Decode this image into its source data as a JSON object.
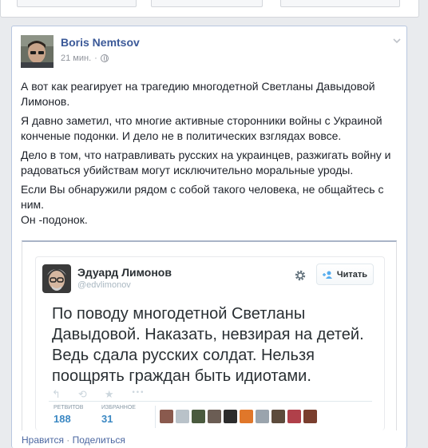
{
  "post": {
    "author": "Boris Nemtsov",
    "time": "21 мин.",
    "time_separator": "·",
    "paragraphs": [
      "А вот как реагирует на трагедию многодетной Светланы Давыдовой Лимонов.",
      "Я давно заметил, что многие активные сторонники войны с Украиной конченые подонки. И дело не в политических взглядах вовсе.",
      "Дело в том, что натравливать русских на украинцев, разжигать войну и радоваться убийствам могут исключительно моральные уроды.",
      "Если Вы обнаружили рядом с собой такого человека, не общайтесь с ним.",
      "Он -подонок."
    ]
  },
  "tweet": {
    "name": "Эдуард Лимонов",
    "handle": "@edvlimonov",
    "follow_label": "Читать",
    "text": "По поводу многодетной Светланы Давыдовой. Наказать, невзирая на детей. Ведь сдала русских солдат. Нельзя поощрять граждан быть идиотами.",
    "retweets_label": "РЕТВИТОВ",
    "retweets": "188",
    "favorites_label": "ИЗБРАННОЕ",
    "favorites": "31",
    "actions": {
      "reply": "↰",
      "retweet": "⟲",
      "favorite": "★",
      "more": "•••"
    },
    "face_colors": [
      "#8a5a4e",
      "#b9c2c9",
      "#4a5a3e",
      "#6b5d54",
      "#2c2c2c",
      "#e0772a",
      "#9aa4ad",
      "#5d4b3c",
      "#b0404a",
      "#7a3e2e"
    ]
  },
  "footer": {
    "like": "Нравится",
    "separator": "·",
    "share": "Поделиться"
  },
  "colors": {
    "link": "#3b5998",
    "twitter_blue": "#3b88c3"
  }
}
